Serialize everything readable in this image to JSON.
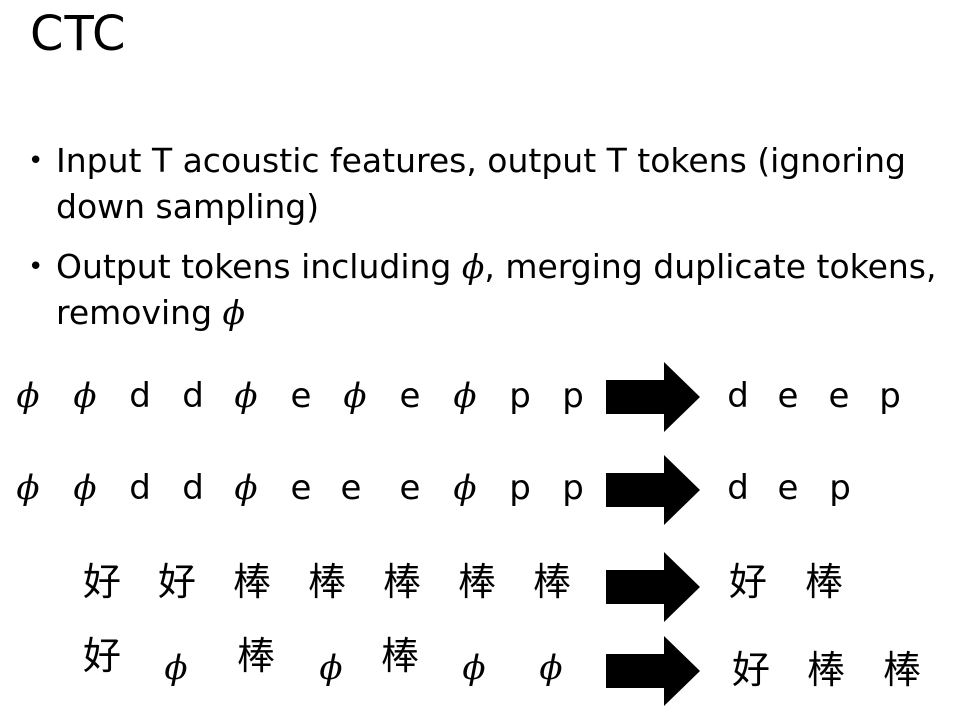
{
  "slide": {
    "title": "CTC",
    "bullets": [
      {
        "text_pre": "Input T acoustic features, output T tokens (ignoring down sampling)",
        "phi_mid": "",
        "text_mid": "",
        "phi_end": ""
      },
      {
        "text_pre": "Output tokens including ",
        "phi_mid": "ϕ",
        "text_mid": ", merging duplicate tokens,  removing ",
        "phi_end": "ϕ"
      }
    ],
    "rows": [
      {
        "input": [
          "ϕ",
          "ϕ",
          "d",
          "d",
          "ϕ",
          "e",
          "ϕ",
          "e",
          "ϕ",
          "p",
          "p"
        ],
        "output": [
          "d",
          "e",
          "e",
          "p"
        ]
      },
      {
        "input": [
          "ϕ",
          "ϕ",
          "d",
          "d",
          "ϕ",
          "e",
          "e",
          "e",
          "ϕ",
          "p",
          "p"
        ],
        "output": [
          "d",
          "e",
          "p"
        ]
      },
      {
        "input": [
          "好",
          "好",
          "棒",
          "棒",
          "棒",
          "棒",
          "棒"
        ],
        "output": [
          "好",
          "棒"
        ]
      },
      {
        "input": [
          "好",
          "ϕ",
          "棒",
          "ϕ",
          "棒",
          "ϕ",
          "ϕ"
        ],
        "output": [
          "好",
          "棒",
          "棒"
        ]
      }
    ],
    "arrow_icon": "right-arrow-icon"
  }
}
